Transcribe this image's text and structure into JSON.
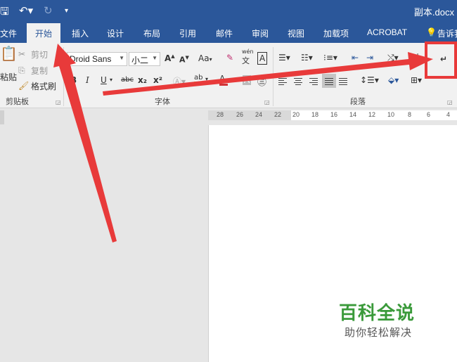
{
  "title_bar": {
    "doc_title": "副本.docx"
  },
  "tabs": [
    {
      "label": "文件"
    },
    {
      "label": "开始"
    },
    {
      "label": "插入"
    },
    {
      "label": "设计"
    },
    {
      "label": "布局"
    },
    {
      "label": "引用"
    },
    {
      "label": "邮件"
    },
    {
      "label": "审阅"
    },
    {
      "label": "视图"
    },
    {
      "label": "加载项"
    },
    {
      "label": "ACROBAT"
    },
    {
      "label": "告诉我"
    }
  ],
  "clipboard": {
    "paste_label": "粘贴",
    "cut_label": "剪切",
    "copy_label": "复制",
    "format_painter_label": "格式刷",
    "group_label": "剪贴板"
  },
  "font": {
    "font_name": "Droid Sans",
    "font_size": "小二",
    "case_button": "Aa",
    "phonetic_top": "wén",
    "phonetic_bottom": "文",
    "border_char": "A",
    "bold": "B",
    "italic": "I",
    "underline": "U",
    "strike": "abc",
    "subscript": "x₂",
    "superscript": "x²",
    "group_label": "字体"
  },
  "paragraph": {
    "group_label": "段落"
  },
  "ruler": {
    "ticks": [
      "28",
      "26",
      "24",
      "22",
      "20",
      "18",
      "16",
      "14",
      "12",
      "10",
      "8",
      "6",
      "4"
    ]
  },
  "watermark": {
    "title": "百科全说",
    "subtitle": "助你轻松解决"
  },
  "colors": {
    "accent": "#2b579a",
    "annotation": "#e83a3a",
    "watermark": "#3a9a3a"
  }
}
